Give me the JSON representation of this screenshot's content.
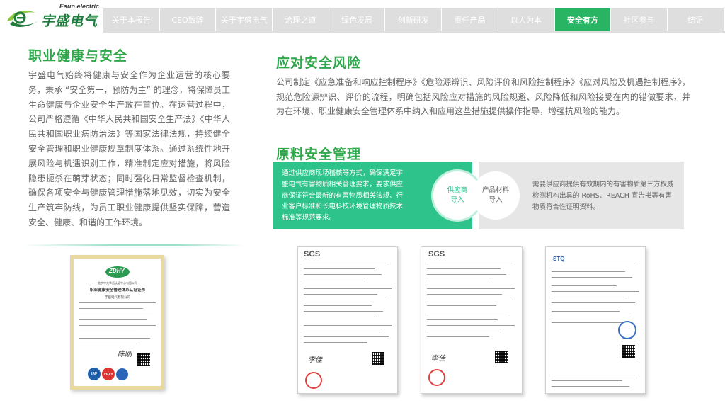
{
  "header": {
    "logo_en": "Esun electric",
    "logo_cn": "宇盛电气",
    "nav": [
      "关于本报告",
      "CEO致辞",
      "关于宇盛电气",
      "治理之道",
      "绿色发展",
      "创新研发",
      "责任产品",
      "以人为本",
      "安全有方",
      "社区参与",
      "结语"
    ],
    "active_index": 8
  },
  "health": {
    "title": "职业健康与安全",
    "body": "宇盛电气始终将健康与安全作为企业运营的核心要务，秉承 “安全第一，预防为主” 的理念，将保障员工生命健康与企业安全生产放在首位。在运营过程中，公司严格遵循《中华人民共和国安全生产法》《中华人民共和国职业病防治法》等国家法律法规，持续健全安全管理和职业健康规章制度体系。通过系统性地开展风险与机遇识别工作，精准制定应对措施，将风险隐患扼杀在萌芽状态；同时强化日常监督检查机制，确保各项安全与健康管理措施落地见效，切实为安全生产筑牢防线，为员工职业健康提供坚实保障，营造安全、健康、和谐的工作环境。"
  },
  "risk": {
    "title": "应对安全风险",
    "body": "公司制定《应急准备和响应控制程序》《危险源辨识、风险评价和风险控制程序》《应对风险及机遇控制程序》，规范危险源辨识、评价的流程，明确包括风险应对措施的风险规避、风险降低和风险接受在内的错做要求，并为在环境、职业健康安全管理体系中纳入和应用这些措施提供操作指导，增强抗风险的能力。"
  },
  "materials": {
    "title": "原料安全管理",
    "green_text": "通过供应商现场稽核等方式，确保满足宇盛电气有害物质相关管理要求，要求供应商保证符合最新的有害物质相关法规、行业客户标准和长电科技环境管理物质技术标准等规范要求。",
    "supplier_label": "供应商导入",
    "material_label": "产品材料导入",
    "gray_text": "需要供应商提供有效期内的有害物质第三方权威检测机构出具的 RoHS、REACH 宣告书等有害物质符合性证明资料。"
  },
  "certificates": {
    "zdhy_logo": "ZDHY",
    "zdhy_issuer": "北京中大华远认证中心有限公司",
    "zdhy_title": "职业健康安全管理体系认证证书",
    "zdhy_company": "宇盛电气有限公司",
    "iaf": "IAF",
    "cnas": "CNAS",
    "sgs": "SGS",
    "stq": "STQ"
  }
}
